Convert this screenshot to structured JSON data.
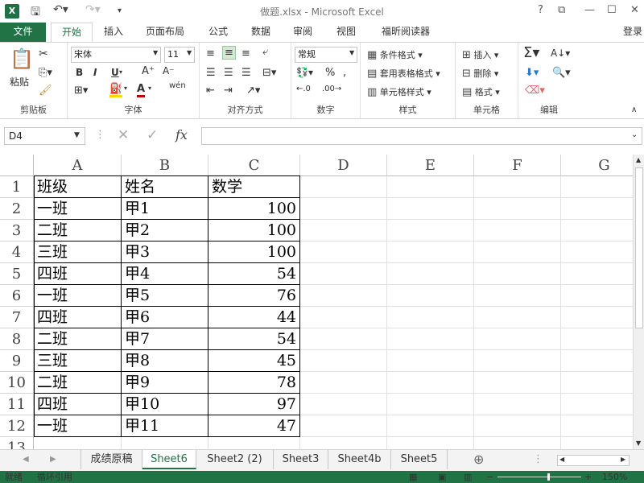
{
  "app": {
    "title": "做题.xlsx - Microsoft Excel",
    "logo": "X",
    "help": "?",
    "signin": "登录"
  },
  "tabs": [
    "文件",
    "开始",
    "插入",
    "页面布局",
    "公式",
    "数据",
    "审阅",
    "视图",
    "福昕阅读器"
  ],
  "ribbon": {
    "clipboard": {
      "label": "剪贴板",
      "paste": "粘贴"
    },
    "font": {
      "label": "字体",
      "name": "宋体",
      "size": "11",
      "bold": "B",
      "italic": "I",
      "underline": "U"
    },
    "alignment": {
      "label": "对齐方式"
    },
    "number": {
      "label": "数字",
      "format": "常规"
    },
    "styles": {
      "label": "样式",
      "cond": "条件格式",
      "table": "套用表格格式",
      "cell": "单元格样式"
    },
    "cells": {
      "label": "单元格",
      "insert": "插入",
      "delete": "删除",
      "format": "格式"
    },
    "editing": {
      "label": "编辑"
    }
  },
  "formula_bar": {
    "name_box": "D4",
    "fx": "fx",
    "value": ""
  },
  "columns": [
    "A",
    "B",
    "C",
    "D",
    "E",
    "F",
    "G"
  ],
  "rows": [
    {
      "n": "1",
      "a": "班级",
      "b": "姓名",
      "c": "数学"
    },
    {
      "n": "2",
      "a": "一班",
      "b": "甲1",
      "c": "100"
    },
    {
      "n": "3",
      "a": "二班",
      "b": "甲2",
      "c": "100"
    },
    {
      "n": "4",
      "a": "三班",
      "b": "甲3",
      "c": "100"
    },
    {
      "n": "5",
      "a": "四班",
      "b": "甲4",
      "c": "54"
    },
    {
      "n": "6",
      "a": "一班",
      "b": "甲5",
      "c": "76"
    },
    {
      "n": "7",
      "a": "四班",
      "b": "甲6",
      "c": "44"
    },
    {
      "n": "8",
      "a": "二班",
      "b": "甲7",
      "c": "54"
    },
    {
      "n": "9",
      "a": "三班",
      "b": "甲8",
      "c": "45"
    },
    {
      "n": "10",
      "a": "二班",
      "b": "甲9",
      "c": "78"
    },
    {
      "n": "11",
      "a": "四班",
      "b": "甲10",
      "c": "97"
    },
    {
      "n": "12",
      "a": "一班",
      "b": "甲11",
      "c": "47"
    },
    {
      "n": "13",
      "a": "",
      "b": "",
      "c": ""
    }
  ],
  "sheets": [
    "成绩原稿",
    "Sheet6",
    "Sheet2 (2)",
    "Sheet3",
    "Sheet4b",
    "Sheet5"
  ],
  "active_sheet": "Sheet6",
  "status": {
    "ready": "就绪",
    "circular": "循环引用",
    "zoom": "150%"
  },
  "colors": {
    "accent": "#217346"
  }
}
